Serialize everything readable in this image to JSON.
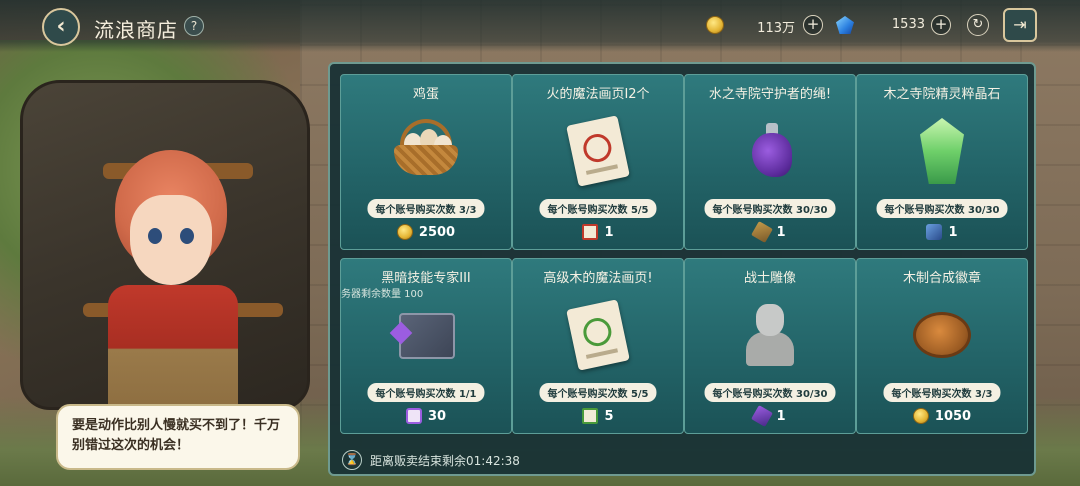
{
  "header": {
    "title": "流浪商店",
    "coin_amount": "113万",
    "gem_amount": "1533"
  },
  "speech": {
    "text": "要是动作比别人慢就买不到了！千万别错过这次的机会！"
  },
  "items": [
    {
      "title": "鸡蛋",
      "subtitle": "",
      "limit": "每个账号购买次数 3/3",
      "price": "2500",
      "price_icon": "gold-coin-icon"
    },
    {
      "title": "火的魔法画页I2个",
      "subtitle": "",
      "limit": "每个账号购买次数 5/5",
      "price": "1",
      "price_icon": "fire-page-icon"
    },
    {
      "title": "水之寺院守护者的绳!",
      "subtitle": "",
      "limit": "每个账号购买次数 30/30",
      "price": "1",
      "price_icon": "feather-icon"
    },
    {
      "title": "木之寺院精灵粹晶石",
      "subtitle": "",
      "limit": "每个账号购买次数 30/30",
      "price": "1",
      "price_icon": "blue-token-icon"
    },
    {
      "title": "黑暗技能专家III",
      "subtitle": "务器剩余数量 100",
      "limit": "每个账号购买次数 1/1",
      "price": "30",
      "price_icon": "purple-page-icon"
    },
    {
      "title": "高级木的魔法画页!",
      "subtitle": "",
      "limit": "每个账号购买次数 5/5",
      "price": "5",
      "price_icon": "wood-page-icon"
    },
    {
      "title": "战士雕像",
      "subtitle": "",
      "limit": "每个账号购买次数 30/30",
      "price": "1",
      "price_icon": "purple-feather-icon"
    },
    {
      "title": "木制合成徽章",
      "subtitle": "",
      "limit": "每个账号购买次数 3/3",
      "price": "1050",
      "price_icon": "gold-coin-icon"
    }
  ],
  "footer": {
    "timer_text": "距离贩卖结束剩余01:42:38"
  }
}
